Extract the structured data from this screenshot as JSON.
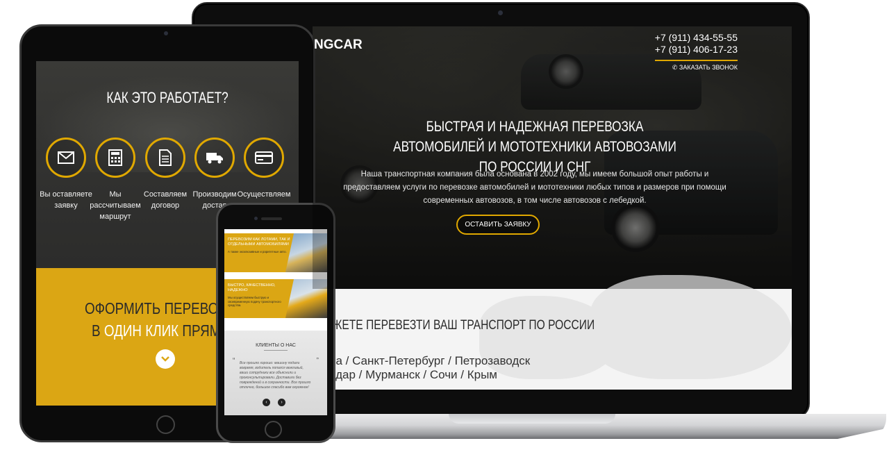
{
  "laptop": {
    "logo": "NGCAR",
    "phones": [
      "+7 (911) 434-55-55",
      "+7 (911) 406-17-23"
    ],
    "call_label": "✆ ЗАКАЗАТЬ ЗВОНОК",
    "title": "БЫСТРАЯ И НАДЕЖНАЯ ПЕРЕВОЗКА АВТОМОБИЛЕЙ И МОТОТЕХНИКИ АВТОВОЗАМИ ПО РОССИИ И СНГ",
    "description": "Наша транспортная компания была основана в 2002 году, мы имеем большой опыт работы и предоставляем услуги по перевозке автомобилей и мототехники любых типов и размеров при помощи современных автовозов, в том числе автовозов с лебедкой.",
    "cta_button": "ОСТАВИТЬ ЗАЯВКУ",
    "map_title": "ЖЕТЕ ПЕРЕВЕЗТИ ВАШ ТРАНСПОРТ ПО РОССИИ",
    "cities_line1": "ра / Санкт-Петербург / Петрозаводск",
    "cities_line2": "одар / Мурманск / Сочи / Крым"
  },
  "tablet": {
    "how_title": "КАК ЭТО РАБОТАЕТ?",
    "steps": [
      {
        "icon": "envelope-icon",
        "label": "Вы оставляете заявку"
      },
      {
        "icon": "calculator-icon",
        "label": "Мы рассчитываем маршрут"
      },
      {
        "icon": "document-icon",
        "label": "Составляем договор"
      },
      {
        "icon": "truck-icon",
        "label": "Производим достав"
      },
      {
        "icon": "credit-card-icon",
        "label": "Осуществляем"
      }
    ],
    "cta_line1": "ОФОРМИТЬ ПЕРЕВОЗК",
    "cta_line2_pre": "В ",
    "cta_line2_highlight": "ОДИН КЛИК",
    "cta_line2_post": " ПРЯМО СЕЙ"
  },
  "phone": {
    "card1_title": "ПЕРЕВОЗИМ КАК ЛОТАМИ, ТАК И ОТДЕЛЬНЫМИ АВТОМОБИЛЯМИ",
    "card1_text": "А также эксклюзивные и раритетные авто.",
    "card2_title": "БЫСТРО, КАЧЕСТВЕННО, НАДЕЖНО",
    "card2_text": "Мы осуществляем быструю и своевременную подачу транспортного средства.",
    "reviews_title": "КЛИЕНТЫ О НАС",
    "review_text": "Все прошло хорошо: машину подали вовремя, водитель попался вежливый, ваши сотрудники все объяснили и проконсультировали. Доставили без повреждений и в сохранности. Все прошло отлично, большое спасибо вам огромное!",
    "prev": "‹",
    "next": "›"
  },
  "colors": {
    "accent": "#dba614",
    "dark": "#2a2a2a"
  }
}
